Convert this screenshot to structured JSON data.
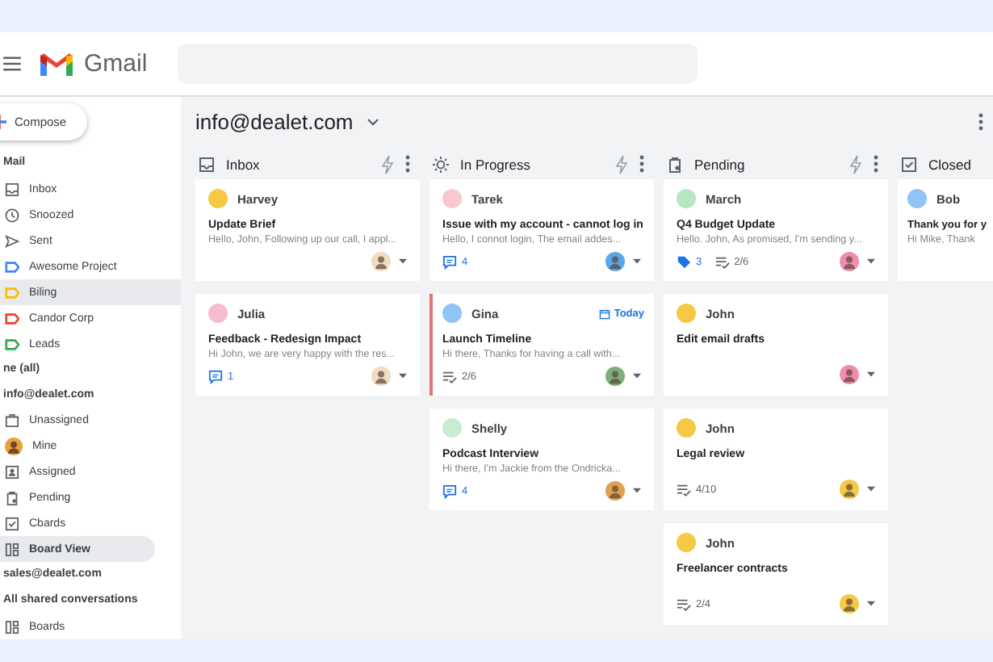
{
  "header": {
    "app_name": "Gmail"
  },
  "sidebar": {
    "compose": "Compose",
    "entries": [
      {
        "kind": "heading",
        "label": "Mail"
      },
      {
        "kind": "link",
        "label": "Inbox",
        "selected": false
      },
      {
        "kind": "link",
        "label": "Snoozed",
        "selected": false
      },
      {
        "kind": "link",
        "label": "Sent",
        "selected": false
      },
      {
        "kind": "label",
        "label": "Awesome Project",
        "color": "#4285f4",
        "selected": false
      },
      {
        "kind": "label",
        "label": "Biling",
        "color": "#fbbc04",
        "selected": true
      },
      {
        "kind": "label",
        "label": "Candor Corp",
        "color": "#ea4335",
        "selected": false
      },
      {
        "kind": "label",
        "label": "Leads",
        "color": "#34a853",
        "selected": false
      },
      {
        "kind": "heading",
        "label": "ne (all)"
      },
      {
        "kind": "heading",
        "label": "info@dealet.com"
      },
      {
        "kind": "link",
        "label": "Unassigned",
        "selected": false
      },
      {
        "kind": "link",
        "label": "Mine",
        "selected": false
      },
      {
        "kind": "link",
        "label": "Assigned",
        "selected": false
      },
      {
        "kind": "link",
        "label": "Pending",
        "selected": false
      },
      {
        "kind": "link",
        "label": "Cbards",
        "selected": false
      },
      {
        "kind": "link",
        "label": "Board View",
        "selected": true
      },
      {
        "kind": "heading",
        "label": "sales@dealet.com"
      },
      {
        "kind": "heading",
        "label": "All shared conversations"
      },
      {
        "kind": "link",
        "label": "Boards",
        "selected": false
      }
    ]
  },
  "board": {
    "title": "info@dealet.com",
    "columns": [
      {
        "title": "Inbox",
        "cards": [
          {
            "name": "Harvey",
            "color": "#f6c945",
            "flagged": false,
            "subject": "Update Brief",
            "snippet": "Hello, John, Following up our call, I appl...",
            "assignee": {
              "color": "#f3dcc4"
            }
          },
          {
            "name": "Julia",
            "color": "#f8bbd0",
            "flagged": false,
            "subject": "Feedback - Redesign Impact",
            "snippet": "Hi John, we are very happy with the res...",
            "badges": [
              {
                "kind": "comments",
                "text": "1"
              }
            ],
            "assignee": {
              "color": "#f3dcc4"
            }
          }
        ]
      },
      {
        "title": "In Progress",
        "cards": [
          {
            "name": "Tarek",
            "color": "#f8c8d0",
            "flagged": false,
            "subject": "Issue with my account - cannot log in",
            "snippet": "Hello, I connot login, The email addes...",
            "badges": [
              {
                "kind": "comments",
                "text": "4"
              }
            ],
            "assignee": {
              "color": "#5aa6e8"
            }
          },
          {
            "name": "Gina",
            "color": "#90c4f4",
            "flagged": true,
            "due": "Today",
            "subject": "Launch Timeline",
            "snippet": "Hi there, Thanks for having a call with...",
            "badges": [
              {
                "kind": "tasks",
                "text": "2/6"
              }
            ],
            "assignee": {
              "color": "#7bb07a"
            }
          },
          {
            "name": "Shelly",
            "color": "#c8ecd0",
            "flagged": false,
            "subject": "Podcast Interview",
            "snippet": "Hi there, I'm Jackie from the Ondricka...",
            "badges": [
              {
                "kind": "comments",
                "text": "4"
              }
            ],
            "assignee": {
              "color": "#e0a050"
            }
          }
        ]
      },
      {
        "title": "Pending",
        "cards": [
          {
            "name": "March",
            "color": "#b8e6c4",
            "flagged": false,
            "subject": "Q4 Budget Update",
            "snippet": "Hello. John, As promised, I'm sending y...",
            "badges": [
              {
                "kind": "tags",
                "text": "3"
              },
              {
                "kind": "tasks",
                "text": "2/6"
              }
            ],
            "assignee": {
              "color": "#f08cb0"
            }
          },
          {
            "name": "John",
            "color": "#f6c945",
            "flagged": false,
            "subject": "Edit email drafts",
            "assignee": {
              "color": "#f08cb0"
            }
          },
          {
            "name": "John",
            "color": "#f6c945",
            "flagged": false,
            "subject": "Legal review",
            "badges": [
              {
                "kind": "tasks",
                "text": "4/10"
              }
            ],
            "assignee": {
              "color": "#f6c945"
            }
          },
          {
            "name": "John",
            "color": "#f6c945",
            "flagged": false,
            "subject": "Freelancer contracts",
            "badges": [
              {
                "kind": "tasks",
                "text": "2/4"
              }
            ],
            "assignee": {
              "color": "#f6c945"
            }
          }
        ]
      },
      {
        "title": "Closed",
        "cards": [
          {
            "name": "Bob",
            "color": "#90c4f4",
            "flagged": false,
            "subject": "Thank you for y",
            "snippet": "Hi Mike, Thank"
          }
        ]
      }
    ]
  }
}
